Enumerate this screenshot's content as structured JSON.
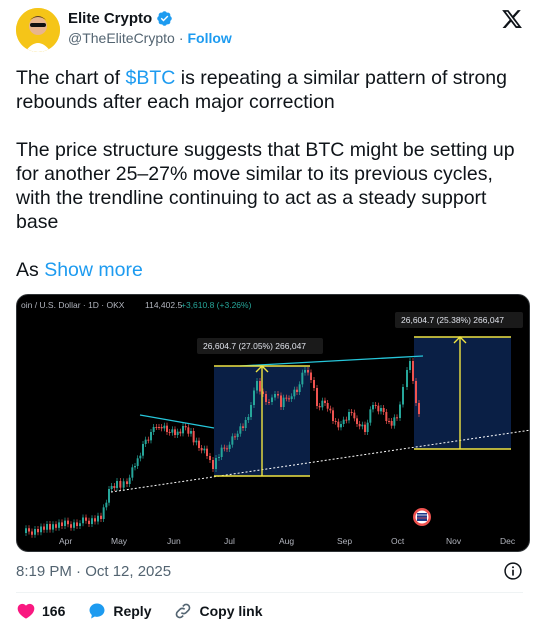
{
  "author": {
    "display_name": "Elite Crypto",
    "handle": "@TheEliteCrypto",
    "separator": "·",
    "follow_label": "Follow"
  },
  "tweet": {
    "p1_before": "The chart of ",
    "p1_cashtag": "$BTC",
    "p1_after": " is repeating a similar pattern of strong rebounds after each major correction",
    "p2": "The price structure suggests that BTC might be setting up for another 25–27% move similar to its previous cycles, with the trendline continuing to act as a steady support base",
    "p3_prefix": "As ",
    "show_more": "Show more"
  },
  "chart": {
    "header_text": "oin / U.S. Dollar · 1D · OKX",
    "header_price": "114,402.5",
    "header_change": "+3,610.8 (+3.26%)",
    "label_left": "26,604.7 (27.05%) 266,047",
    "label_right": "26,604.7 (25.38%) 266,047",
    "months": [
      "Apr",
      "May",
      "Jun",
      "Jul",
      "Aug",
      "Sep",
      "Oct",
      "Nov",
      "Dec"
    ]
  },
  "meta": {
    "timestamp": "8:19 PM · Oct 12, 2025"
  },
  "actions": {
    "likes": "166",
    "reply_label": "Reply",
    "copy_label": "Copy link"
  },
  "colors": {
    "accent": "#1d9bf0",
    "like": "#f91880",
    "candle_up": "#26a69a",
    "candle_down": "#ef5350",
    "measure_yellow": "#f0e442",
    "trendline": "#26c6da"
  }
}
